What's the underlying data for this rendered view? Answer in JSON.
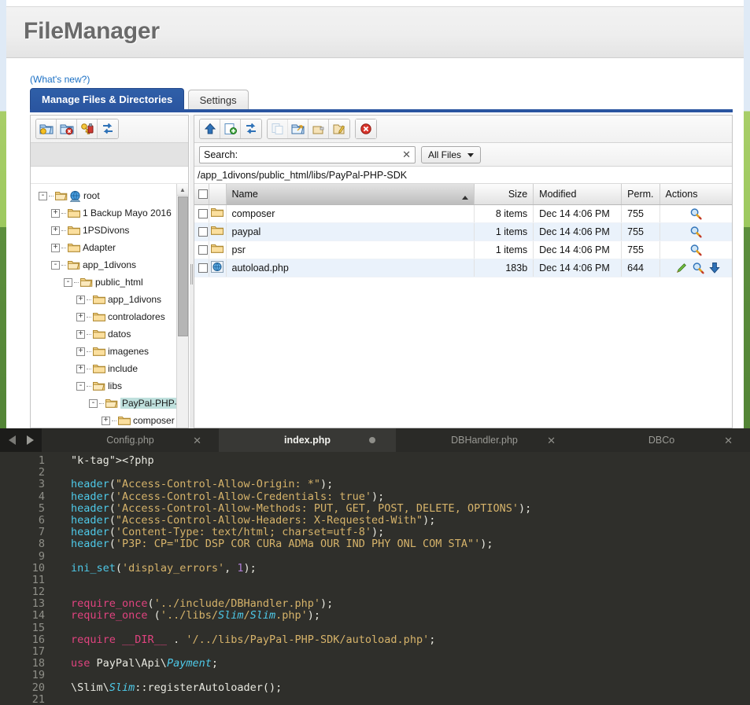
{
  "app": {
    "title": "FileManager",
    "whats_new": "(What's new?)",
    "whats_new_text": "What's new?"
  },
  "tabs": [
    {
      "label": "Manage Files & Directories",
      "active": true
    },
    {
      "label": "Settings",
      "active": false
    }
  ],
  "left_toolbar": [
    {
      "name": "new-folder-icon",
      "label": "Create Directory",
      "disabled": false
    },
    {
      "name": "delete-folder-icon",
      "label": "Delete Directory",
      "disabled": false
    },
    {
      "name": "permissions-icon",
      "label": "Change Permissions",
      "disabled": false
    },
    {
      "name": "refresh-icon",
      "label": "Refresh",
      "disabled": false
    }
  ],
  "right_toolbar": [
    {
      "name": "up-directory-icon",
      "label": "Up One Level",
      "disabled": false
    },
    {
      "name": "new-file-icon",
      "label": "New File",
      "disabled": false
    },
    {
      "name": "refresh-icon",
      "label": "Refresh",
      "disabled": false
    },
    {
      "name": "copy-icon",
      "label": "Copy",
      "disabled": true
    },
    {
      "name": "move-icon",
      "label": "Move",
      "disabled": false
    },
    {
      "name": "rename-icon",
      "label": "Rename",
      "disabled": false
    },
    {
      "name": "edit-file-icon",
      "label": "Edit",
      "disabled": false
    },
    {
      "name": "delete-icon",
      "label": "Delete",
      "disabled": false
    }
  ],
  "search": {
    "label": "Search:",
    "value": "",
    "placeholder": "",
    "clear_glyph": "✕",
    "filter_label": "All Files"
  },
  "breadcrumb": "/app_1divons/public_html/libs/PayPal-PHP-SDK",
  "table": {
    "columns": [
      "Name",
      "Size",
      "Modified",
      "Perm.",
      "Actions"
    ],
    "sorted_column": "Name",
    "sort_direction": "asc",
    "rows": [
      {
        "icon": "folder-icon",
        "name": "composer",
        "size": "8 items",
        "modified": "Dec 14 4:06 PM",
        "perm": "755",
        "actions": [
          "view-icon"
        ]
      },
      {
        "icon": "folder-icon",
        "name": "paypal",
        "size": "1 items",
        "modified": "Dec 14 4:06 PM",
        "perm": "755",
        "actions": [
          "view-icon"
        ]
      },
      {
        "icon": "folder-icon",
        "name": "psr",
        "size": "1 items",
        "modified": "Dec 14 4:06 PM",
        "perm": "755",
        "actions": [
          "view-icon"
        ]
      },
      {
        "icon": "php-file-icon",
        "name": "autoload.php",
        "size": "183b",
        "modified": "Dec 14 4:06 PM",
        "perm": "644",
        "actions": [
          "edit-icon",
          "view-icon",
          "download-icon"
        ]
      }
    ]
  },
  "tree": [
    {
      "depth": 0,
      "glyph": "-",
      "icon": "folder-open-icon",
      "globe": true,
      "label": "root",
      "selected": false
    },
    {
      "depth": 1,
      "glyph": "+",
      "icon": "folder-icon",
      "globe": false,
      "label": "1 Backup Mayo 2016",
      "selected": false
    },
    {
      "depth": 1,
      "glyph": "+",
      "icon": "folder-icon",
      "globe": false,
      "label": "1PSDivons",
      "selected": false
    },
    {
      "depth": 1,
      "glyph": "+",
      "icon": "folder-icon",
      "globe": false,
      "label": "Adapter",
      "selected": false
    },
    {
      "depth": 1,
      "glyph": "-",
      "icon": "folder-open-icon",
      "globe": false,
      "label": "app_1divons",
      "selected": false
    },
    {
      "depth": 2,
      "glyph": "-",
      "icon": "folder-open-icon",
      "globe": false,
      "label": "public_html",
      "selected": false
    },
    {
      "depth": 3,
      "glyph": "+",
      "icon": "folder-icon",
      "globe": false,
      "label": "app_1divons",
      "selected": false
    },
    {
      "depth": 3,
      "glyph": "+",
      "icon": "folder-icon",
      "globe": false,
      "label": "controladores",
      "selected": false
    },
    {
      "depth": 3,
      "glyph": "+",
      "icon": "folder-icon",
      "globe": false,
      "label": "datos",
      "selected": false
    },
    {
      "depth": 3,
      "glyph": "+",
      "icon": "folder-icon",
      "globe": false,
      "label": "imagenes",
      "selected": false
    },
    {
      "depth": 3,
      "glyph": "+",
      "icon": "folder-icon",
      "globe": false,
      "label": "include",
      "selected": false
    },
    {
      "depth": 3,
      "glyph": "-",
      "icon": "folder-open-icon",
      "globe": false,
      "label": "libs",
      "selected": false
    },
    {
      "depth": 4,
      "glyph": "-",
      "icon": "folder-open-icon",
      "globe": false,
      "label": "PayPal-PHP-S",
      "selected": true
    },
    {
      "depth": 5,
      "glyph": "+",
      "icon": "folder-icon",
      "globe": false,
      "label": "composer",
      "selected": false
    }
  ],
  "editor": {
    "nav": {
      "back": "back-arrow-icon",
      "forward": "forward-arrow-icon"
    },
    "tabs": [
      {
        "label": "Config.php",
        "active": false,
        "modified": false,
        "close_glyph": "✕"
      },
      {
        "label": "index.php",
        "active": true,
        "modified": true,
        "close_glyph": "✕"
      },
      {
        "label": "DBHandler.php",
        "active": false,
        "modified": false,
        "close_glyph": "✕"
      },
      {
        "label": "DBCo",
        "active": false,
        "modified": false,
        "close_glyph": "✕"
      }
    ],
    "line_numbers": [
      1,
      2,
      3,
      4,
      5,
      6,
      7,
      8,
      9,
      10,
      11,
      12,
      13,
      14,
      15,
      16,
      17,
      18,
      19,
      20,
      21
    ],
    "lines": [
      "<?php",
      "",
      "header(\"Access-Control-Allow-Origin: *\");",
      "header('Access-Control-Allow-Credentials: true');",
      "header('Access-Control-Allow-Methods: PUT, GET, POST, DELETE, OPTIONS');",
      "header(\"Access-Control-Allow-Headers: X-Requested-With\");",
      "header('Content-Type: text/html; charset=utf-8');",
      "header('P3P: CP=\"IDC DSP COR CURa ADMa OUR IND PHY ONL COM STA\"');",
      "",
      "ini_set('display_errors', 1);",
      "",
      "",
      "require_once('../include/DBHandler.php');",
      "require_once ('../libs/Slim/Slim.php');",
      "",
      "require __DIR__ . '/../libs/PayPal-PHP-SDK/autoload.php';",
      "",
      "use PayPal\\Api\\Payment;",
      "",
      "\\Slim\\Slim::registerAutoloader();",
      ""
    ]
  },
  "colors": {
    "tab_active": "#2a55a0",
    "link": "#1f7ad1",
    "row_alt": "#eaf2fb",
    "tree_selected": "#bfe0dd",
    "editor_bg": "#2f2f2b",
    "editor_tabbar": "#0a0c10",
    "desktop_green": "#9dc95f"
  }
}
